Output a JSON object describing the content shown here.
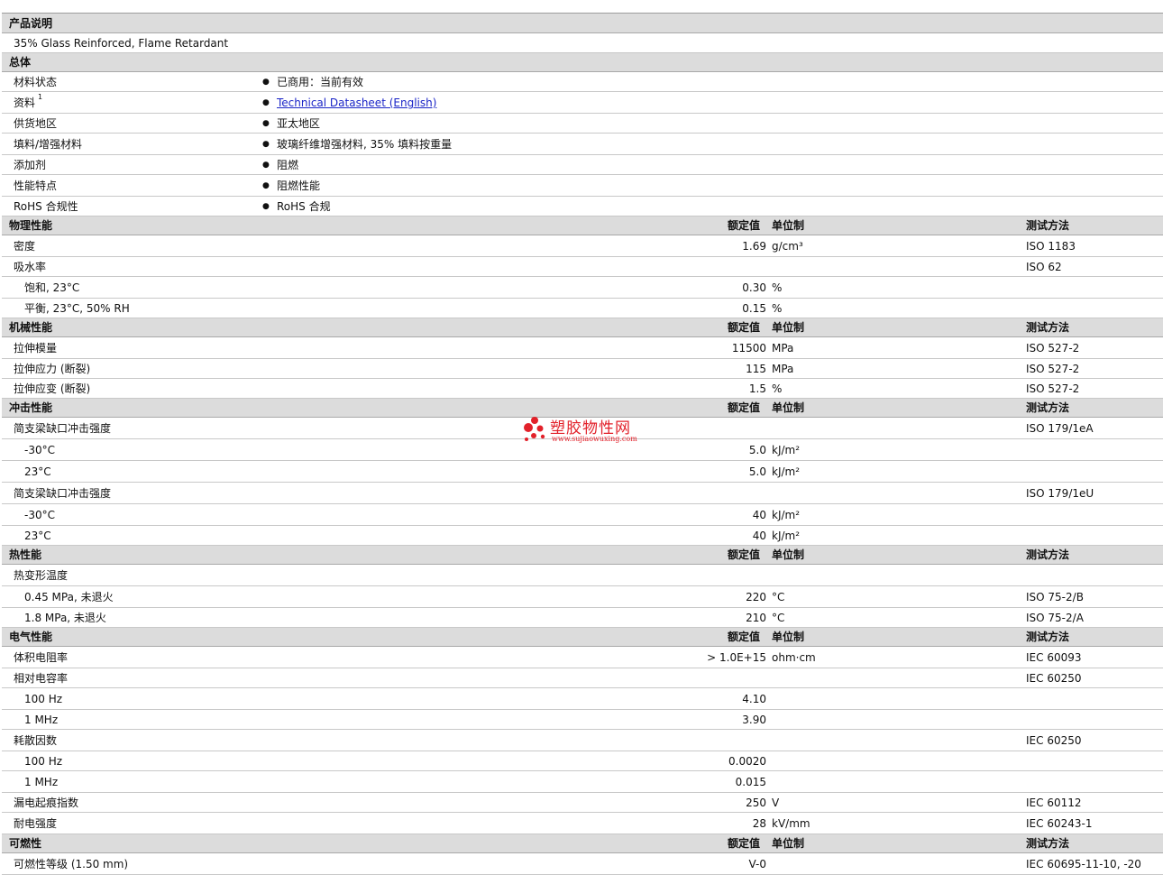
{
  "description": {
    "header": "产品说明",
    "text": "35% Glass Reinforced, Flame Retardant"
  },
  "general": {
    "header": "总体",
    "rows": [
      {
        "label": "材料状态",
        "value": "已商用：当前有效"
      },
      {
        "label": "资料",
        "sup": "1",
        "value": "Technical Datasheet (English)"
      },
      {
        "label": "供货地区",
        "value": "亚太地区"
      },
      {
        "label": "填料/增强材料",
        "value": "玻璃纤维增强材料, 35% 填料按重量"
      },
      {
        "label": "添加剂",
        "value": "阻燃"
      },
      {
        "label": "性能特点",
        "value": "阻燃性能"
      },
      {
        "label": "RoHS 合规性",
        "value": "RoHS 合规"
      }
    ]
  },
  "columns": {
    "value": "额定值",
    "unit": "单位制",
    "test": "测试方法"
  },
  "physical": {
    "header": "物理性能",
    "rows": [
      {
        "label": "密度",
        "value": "1.69",
        "unit": "g/cm³",
        "test": "ISO 1183"
      },
      {
        "label": "吸水率",
        "value": "",
        "unit": "",
        "test": "ISO 62"
      },
      {
        "label": "饱和, 23°C",
        "value": "0.30",
        "unit": "%",
        "test": ""
      },
      {
        "label": "平衡, 23°C, 50% RH",
        "value": "0.15",
        "unit": "%",
        "test": ""
      }
    ]
  },
  "mechanical": {
    "header": "机械性能",
    "rows": [
      {
        "label": "拉伸模量",
        "value": "11500",
        "unit": "MPa",
        "test": "ISO 527-2"
      },
      {
        "label": "拉伸应力 (断裂)",
        "value": "115",
        "unit": "MPa",
        "test": "ISO 527-2"
      },
      {
        "label": "拉伸应变 (断裂)",
        "value": "1.5",
        "unit": "%",
        "test": "ISO 527-2"
      }
    ]
  },
  "impact": {
    "header": "冲击性能",
    "rows": [
      {
        "label": "简支梁缺口冲击强度",
        "value": "",
        "unit": "",
        "test": "ISO 179/1eA"
      },
      {
        "label": "-30°C",
        "value": "5.0",
        "unit": "kJ/m²",
        "test": ""
      },
      {
        "label": "23°C",
        "value": "5.0",
        "unit": "kJ/m²",
        "test": ""
      },
      {
        "label": "简支梁缺口冲击强度",
        "value": "",
        "unit": "",
        "test": "ISO 179/1eU"
      },
      {
        "label": "-30°C",
        "value": "40",
        "unit": "kJ/m²",
        "test": ""
      },
      {
        "label": "23°C",
        "value": "40",
        "unit": "kJ/m²",
        "test": ""
      }
    ]
  },
  "thermal": {
    "header": "热性能",
    "rows": [
      {
        "label": "热变形温度",
        "value": "",
        "unit": "",
        "test": ""
      },
      {
        "label": "0.45 MPa, 未退火",
        "value": "220",
        "unit": "°C",
        "test": "ISO 75-2/B"
      },
      {
        "label": "1.8 MPa, 未退火",
        "value": "210",
        "unit": "°C",
        "test": "ISO 75-2/A"
      }
    ]
  },
  "electrical": {
    "header": "电气性能",
    "rows": [
      {
        "label": "体积电阻率",
        "value": "> 1.0E+15",
        "unit": "ohm·cm",
        "test": "IEC 60093"
      },
      {
        "label": "相对电容率",
        "value": "",
        "unit": "",
        "test": "IEC 60250"
      },
      {
        "label": "100 Hz",
        "value": "4.10",
        "unit": "",
        "test": ""
      },
      {
        "label": "1 MHz",
        "value": "3.90",
        "unit": "",
        "test": ""
      },
      {
        "label": "耗散因数",
        "value": "",
        "unit": "",
        "test": "IEC 60250"
      },
      {
        "label": "100 Hz",
        "value": "0.0020",
        "unit": "",
        "test": ""
      },
      {
        "label": "1 MHz",
        "value": "0.015",
        "unit": "",
        "test": ""
      },
      {
        "label": "漏电起痕指数",
        "value": "250",
        "unit": "V",
        "test": "IEC 60112"
      },
      {
        "label": "耐电强度",
        "value": "28",
        "unit": "kV/mm",
        "test": "IEC 60243-1"
      }
    ]
  },
  "flammability": {
    "header": "可燃性",
    "rows": [
      {
        "label": "可燃性等级 (1.50 mm)",
        "value": "V-0",
        "unit": "",
        "test": "IEC 60695-11-10, -20"
      }
    ]
  },
  "watermark": {
    "title": "塑胶物性网",
    "url": "www.sujiaowuxing.com",
    "color": "#e2212a"
  }
}
